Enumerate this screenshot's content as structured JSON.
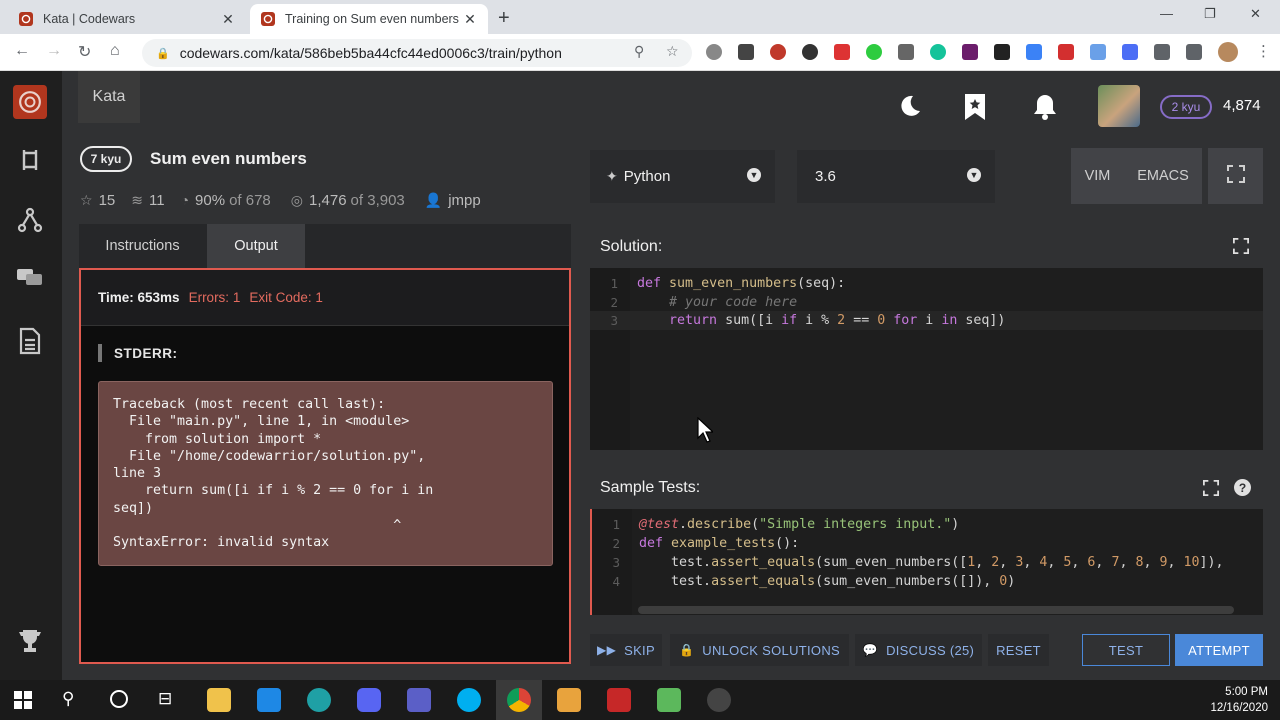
{
  "browser": {
    "tabs": [
      {
        "title": "Kata | Codewars",
        "active": false
      },
      {
        "title": "Training on Sum even numbers |",
        "active": true
      }
    ],
    "url": "codewars.com/kata/586beb5ba44cfc44ed0006c3/train/python"
  },
  "header": {
    "nav_tab": "Kata",
    "rank": "2 kyu",
    "honor": "4,874"
  },
  "kata": {
    "rank": "7 kyu",
    "title": "Sum even numbers",
    "stars": "15",
    "collections": "11",
    "satisfaction": "90%",
    "satisfaction_of": "of 678",
    "completed": "1,476",
    "completed_of": "of 3,903",
    "author": "jmpp"
  },
  "left_panel": {
    "tabs": [
      "Instructions",
      "Output"
    ],
    "active_tab": "Output",
    "time": "Time: 653ms",
    "errors": "Errors: 1",
    "exit_code": "Exit Code: 1",
    "stderr_label": "STDERR:",
    "traceback": "Traceback (most recent call last):\n  File \"main.py\", line 1, in <module>\n    from solution import *\n  File \"/home/codewarrior/solution.py\",\nline 3\n    return sum([i if i % 2 == 0 for i in\nseq])\n                                   ^\nSyntaxError: invalid syntax"
  },
  "editor_bar": {
    "language": "Python",
    "version": "3.6",
    "modes": [
      "VIM",
      "EMACS"
    ]
  },
  "solution": {
    "label": "Solution:",
    "line_numbers": [
      "1",
      "2",
      "3"
    ]
  },
  "sample_tests": {
    "label": "Sample Tests:",
    "line_numbers": [
      "1",
      "2",
      "3",
      "4"
    ]
  },
  "actions": {
    "skip": "SKIP",
    "unlock": "UNLOCK SOLUTIONS",
    "discuss": "DISCUSS (25)",
    "reset": "RESET",
    "test": "TEST",
    "attempt": "ATTEMPT"
  },
  "taskbar": {
    "time": "5:00 PM",
    "date": "12/16/2020"
  },
  "colors": {
    "error": "#e05a4f",
    "accent_blue": "#4a88d9",
    "rank_purple": "#866cc7"
  }
}
